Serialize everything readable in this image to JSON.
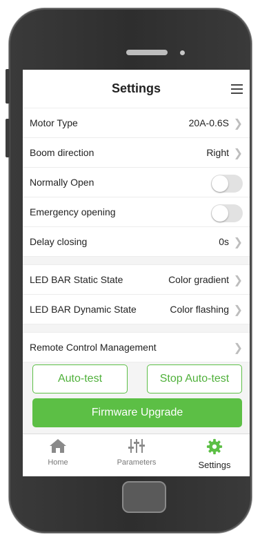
{
  "header": {
    "title": "Settings"
  },
  "rows_group1": [
    {
      "label": "Motor Type",
      "value": "20A-0.6S",
      "kind": "select"
    },
    {
      "label": "Boom direction",
      "value": "Right",
      "kind": "select"
    },
    {
      "label": "Normally Open",
      "kind": "toggle",
      "on": false
    },
    {
      "label": "Emergency opening",
      "kind": "toggle",
      "on": false
    },
    {
      "label": "Delay closing",
      "value": "0s",
      "kind": "select"
    }
  ],
  "rows_group2": [
    {
      "label": "LED BAR Static State",
      "value": "Color gradient"
    },
    {
      "label": "LED BAR Dynamic State",
      "value": "Color flashing"
    }
  ],
  "remote": {
    "label": "Remote Control Management"
  },
  "buttons": {
    "auto_test": "Auto-test",
    "stop_auto_test": "Stop Auto-test",
    "firmware_upgrade": "Firmware Upgrade"
  },
  "tabs": [
    {
      "label": "Home",
      "icon": "home-icon",
      "active": false
    },
    {
      "label": "Parameters",
      "icon": "sliders-icon",
      "active": false
    },
    {
      "label": "Settings",
      "icon": "gear-icon",
      "active": true
    }
  ],
  "colors": {
    "accent": "#5cbf45",
    "frame": "#333333"
  }
}
